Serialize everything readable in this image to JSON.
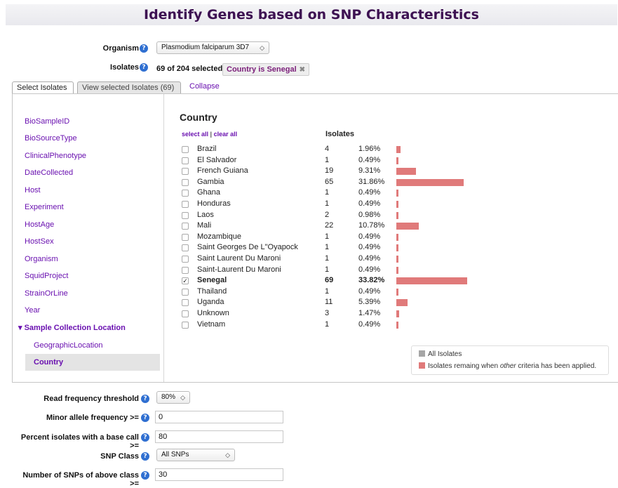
{
  "page": {
    "title": "Identify Genes based on SNP Characteristics"
  },
  "organism": {
    "label": "Organism",
    "value": "Plasmodium falciparum 3D7"
  },
  "isolates": {
    "label": "Isolates",
    "count_text": "69 of 204 selected",
    "filter_chip": "Country is Senegal",
    "chip_close": "✖"
  },
  "tabs": [
    {
      "label": "Select Isolates"
    },
    {
      "label": "View selected Isolates (69)"
    }
  ],
  "collapse_label": "Collapse",
  "sidebar": {
    "items": [
      {
        "label": "BioSampleID"
      },
      {
        "label": "BioSourceType"
      },
      {
        "label": "ClinicalPhenotype"
      },
      {
        "label": "DateCollected"
      },
      {
        "label": "Host"
      },
      {
        "label": "Experiment"
      },
      {
        "label": "HostAge"
      },
      {
        "label": "HostSex"
      },
      {
        "label": "Organism"
      },
      {
        "label": "SquidProject"
      },
      {
        "label": "StrainOrLine"
      },
      {
        "label": "Year"
      }
    ],
    "group": {
      "label": "▾ Sample Collection Location"
    },
    "sub_items": [
      {
        "label": "GeographicLocation"
      },
      {
        "label": "Country"
      }
    ]
  },
  "filter_panel": {
    "title": "Country",
    "select_all": "select all",
    "separator": "|",
    "clear_all": "clear all",
    "isolates_header": "Isolates",
    "rows": [
      {
        "name": "Brazil",
        "count": "4",
        "pct": "1.96%",
        "fraction": 0.0196,
        "checked": false
      },
      {
        "name": "El Salvador",
        "count": "1",
        "pct": "0.49%",
        "fraction": 0.0049,
        "checked": false
      },
      {
        "name": "French Guiana",
        "count": "19",
        "pct": "9.31%",
        "fraction": 0.0931,
        "checked": false
      },
      {
        "name": "Gambia",
        "count": "65",
        "pct": "31.86%",
        "fraction": 0.3186,
        "checked": false
      },
      {
        "name": "Ghana",
        "count": "1",
        "pct": "0.49%",
        "fraction": 0.0049,
        "checked": false
      },
      {
        "name": "Honduras",
        "count": "1",
        "pct": "0.49%",
        "fraction": 0.0049,
        "checked": false
      },
      {
        "name": "Laos",
        "count": "2",
        "pct": "0.98%",
        "fraction": 0.0098,
        "checked": false
      },
      {
        "name": "Mali",
        "count": "22",
        "pct": "10.78%",
        "fraction": 0.1078,
        "checked": false
      },
      {
        "name": "Mozambique",
        "count": "1",
        "pct": "0.49%",
        "fraction": 0.0049,
        "checked": false
      },
      {
        "name": "Saint Georges De L\"Oyapock",
        "count": "1",
        "pct": "0.49%",
        "fraction": 0.0049,
        "checked": false
      },
      {
        "name": "Saint Laurent Du Maroni",
        "count": "1",
        "pct": "0.49%",
        "fraction": 0.0049,
        "checked": false
      },
      {
        "name": "Saint-Laurent Du Maroni",
        "count": "1",
        "pct": "0.49%",
        "fraction": 0.0049,
        "checked": false
      },
      {
        "name": "Senegal",
        "count": "69",
        "pct": "33.82%",
        "fraction": 0.3382,
        "checked": true
      },
      {
        "name": "Thailand",
        "count": "1",
        "pct": "0.49%",
        "fraction": 0.0049,
        "checked": false
      },
      {
        "name": "Uganda",
        "count": "11",
        "pct": "5.39%",
        "fraction": 0.0539,
        "checked": false
      },
      {
        "name": "Unknown",
        "count": "3",
        "pct": "1.47%",
        "fraction": 0.0147,
        "checked": false
      },
      {
        "name": "Vietnam",
        "count": "1",
        "pct": "0.49%",
        "fraction": 0.0049,
        "checked": false
      }
    ],
    "legend": {
      "all_label": "All Isolates",
      "remaining_prefix": "Isolates remaing when ",
      "remaining_em": "other",
      "remaining_suffix": " criteria has been applied.",
      "all_color": "#a6a6a6",
      "remaining_color": "#e07a7a"
    }
  },
  "params": {
    "read_freq": {
      "label": "Read frequency threshold",
      "value": "80%"
    },
    "minor_allele": {
      "label": "Minor allele frequency >=",
      "value": "0"
    },
    "pct_base_call": {
      "label": "Percent isolates with a base call >=",
      "value": "80"
    },
    "snp_class": {
      "label": "SNP Class",
      "value": "All SNPs"
    },
    "num_snps": {
      "label": "Number of SNPs of above class >=",
      "value": "30"
    }
  },
  "icons": {
    "help": "help-icon",
    "chevron": "chevron-updown-icon",
    "close": "close-icon",
    "check": "check-icon"
  }
}
